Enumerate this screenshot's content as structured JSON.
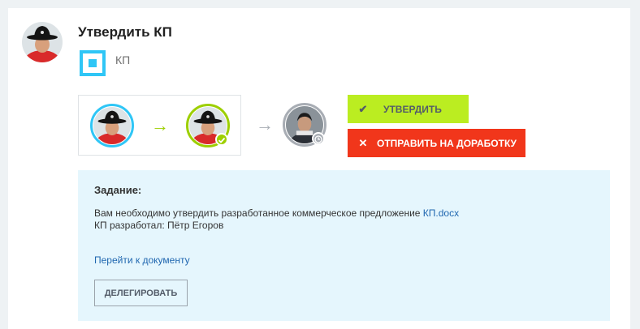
{
  "task": {
    "title": "Утвердить КП",
    "document_name": "КП"
  },
  "route": {
    "arrow_glyph": "→",
    "participants": [
      {
        "role": "author",
        "ring_color": "#2fc6f6"
      },
      {
        "role": "current-approver",
        "ring_color": "#9dcf00",
        "status_icon": "check-icon"
      },
      {
        "role": "next-approver",
        "ring_color": "#a8adb4",
        "status_icon": "clock-icon"
      }
    ]
  },
  "actions": {
    "approve_label": "УТВЕРДИТЬ",
    "approve_icon": "✔",
    "reject_label": "ОТПРАВИТЬ НА ДОРАБОТКУ",
    "reject_icon": "✕"
  },
  "details": {
    "heading": "Задание:",
    "text_prefix": "Вам необходимо утвердить разработанное коммерческое предложение ",
    "file_link": "КП.docx",
    "author_line": "КП разработал: Пётр Егоров",
    "goto_link": "Перейти к документу",
    "delegate_label": "ДЕЛЕГИРОВАТЬ"
  },
  "colors": {
    "approve": "#bbed21",
    "reject": "#f1361b",
    "link": "#2067b0",
    "task_bg": "#e5f6fd",
    "doc_icon": "#2fc6f6"
  }
}
